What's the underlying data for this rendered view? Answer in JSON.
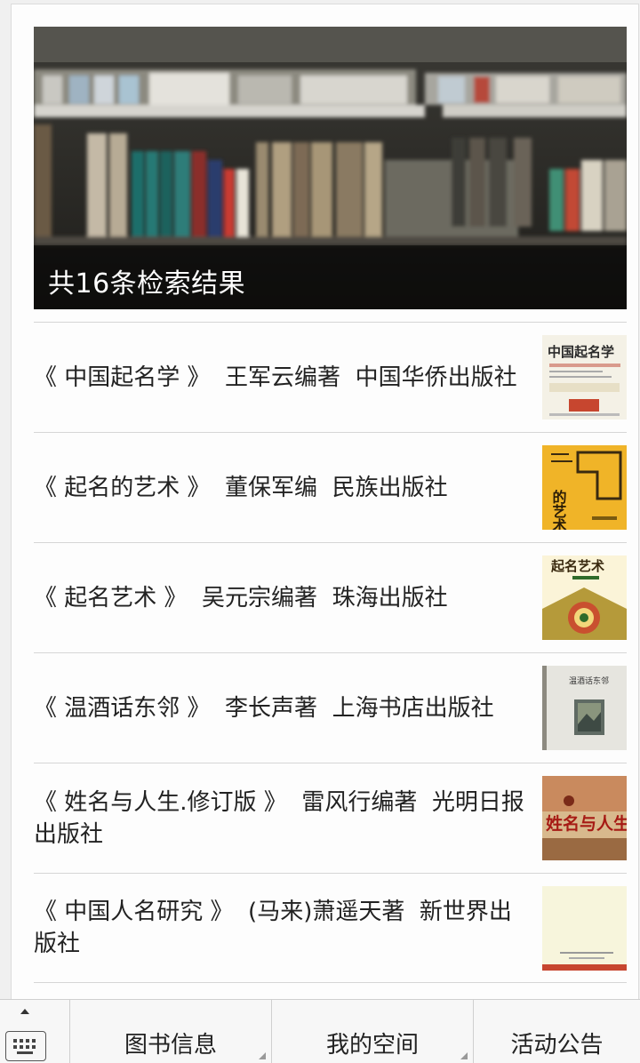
{
  "banner": {
    "caption": "共16条检索结果"
  },
  "results": [
    {
      "text": "《 中国起名学 》  王军云编著  中国华侨出版社",
      "cover_title": "中国起名学",
      "cover_icon": "book-cover-zhongguo-qimingxue"
    },
    {
      "text": "《 起名的艺术 》  董保军编  民族出版社",
      "cover_title": "的艺术",
      "cover_icon": "book-cover-qiming-de-yishu"
    },
    {
      "text": "《 起名艺术 》  吴元宗编著  珠海出版社",
      "cover_title": "起名艺术",
      "cover_icon": "book-cover-qiming-yishu"
    },
    {
      "text": "《 温酒话东邻 》  李长声著  上海书店出版社",
      "cover_title": "温酒话东邻",
      "cover_icon": "book-cover-wenjiu-hua-donglin"
    },
    {
      "text": "《 姓名与人生.修订版 》  雷风行编著  光明日报出版社",
      "cover_title": "姓名与人生",
      "cover_icon": "book-cover-xingming-yu-rensheng"
    },
    {
      "text": "《 中国人名研究 》  (马来)萧遥天著  新世界出版社",
      "cover_title": "",
      "cover_icon": "book-cover-zhongguo-renming-yanjiu"
    }
  ],
  "tabbar": {
    "keyboard_icon": "keyboard-icon",
    "tabs": [
      "图书信息",
      "我的空间",
      "活动公告"
    ]
  },
  "colors": {
    "page_bg": "#fdfdfd",
    "divider": "#d6d6d6",
    "text": "#222222",
    "tabbar_bg": "#f7f7f7"
  }
}
